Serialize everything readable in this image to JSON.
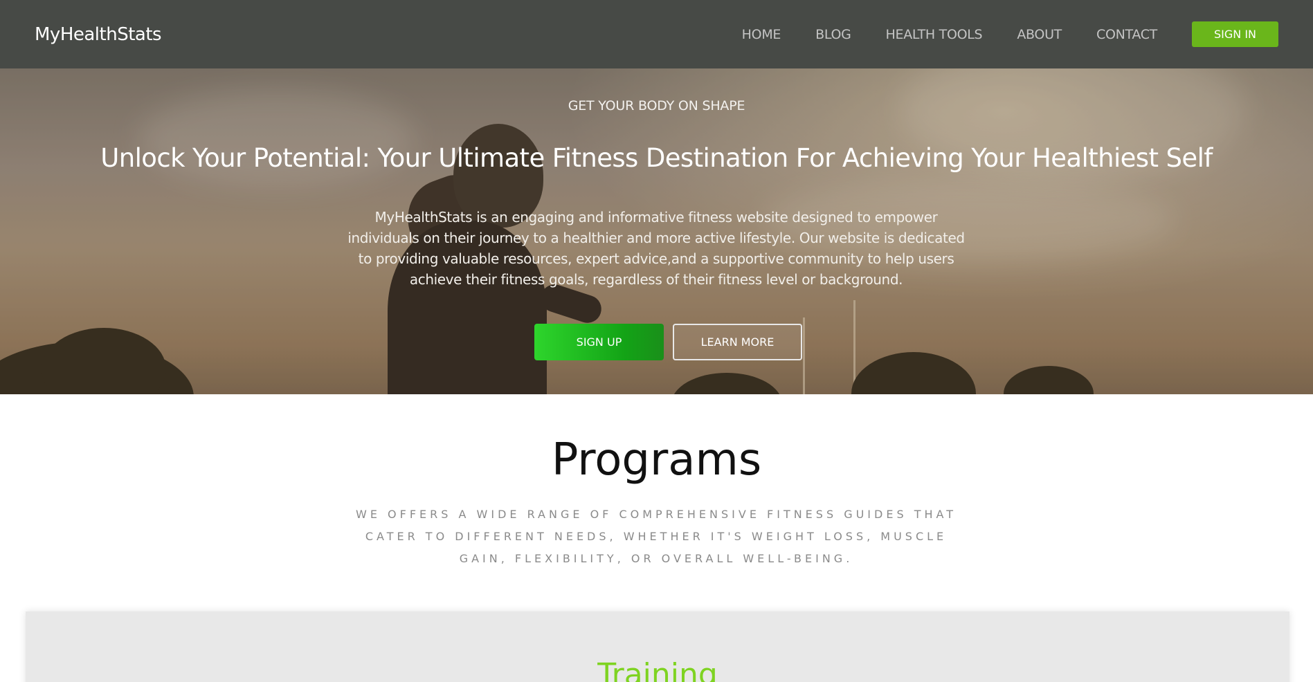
{
  "brand": "MyHealthStats",
  "nav": {
    "items": [
      {
        "label": "HOME"
      },
      {
        "label": "BLOG"
      },
      {
        "label": "HEALTH TOOLS"
      },
      {
        "label": "ABOUT"
      },
      {
        "label": "CONTACT"
      }
    ],
    "signin_label": "SIGN IN"
  },
  "hero": {
    "eyebrow": "GET YOUR BODY ON SHAPE",
    "title": "Unlock Your Potential: Your Ultimate Fitness Destination For Achieving Your Healthiest Self",
    "description": "MyHealthStats is an engaging and informative fitness website designed to empower individuals on their journey to a healthier and more active lifestyle. Our website is dedicated to providing valuable resources, expert advice,and a supportive community to help users achieve their fitness goals, regardless of their fitness level or background.",
    "signup_label": "SIGN UP",
    "learn_more_label": "LEARN MORE"
  },
  "programs": {
    "title": "Programs",
    "description": "We offers a wide range of comprehensive fitness guides that cater to different needs, whether it's weight loss, muscle gain, flexibility, or overall well-being.",
    "cards": [
      {
        "title": "Training"
      }
    ]
  },
  "colors": {
    "navbar_bg": "#474a46",
    "accent_green": "#6ab61b",
    "signup_green": "#1fc21f",
    "training_title": "#7ed321",
    "card_bg": "#e8e8e8"
  }
}
